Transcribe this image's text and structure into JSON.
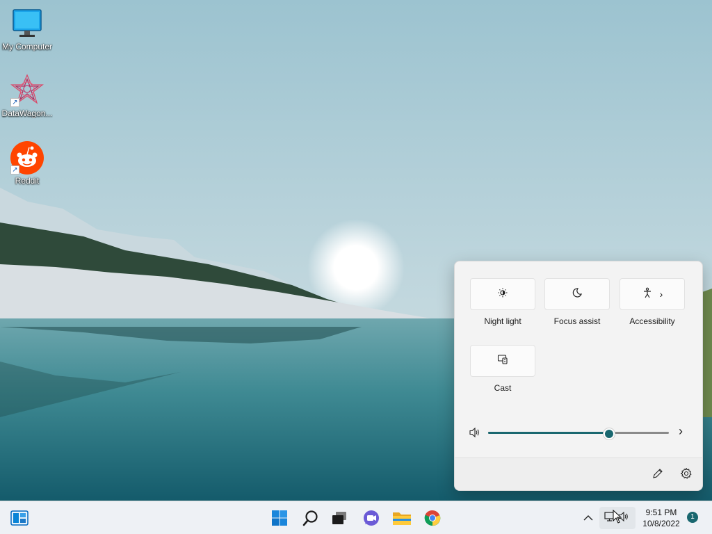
{
  "desktop": {
    "icons": [
      {
        "label": "My Computer"
      },
      {
        "label": "DataWagon..."
      },
      {
        "label": "Reddit"
      }
    ]
  },
  "quick_settings": {
    "tiles": [
      {
        "label": "Night light",
        "icon": "brightness-icon"
      },
      {
        "label": "Focus assist",
        "icon": "moon-icon"
      },
      {
        "label": "Accessibility",
        "icon": "accessibility-icon",
        "chevron": "›"
      },
      {
        "label": "Cast",
        "icon": "cast-icon"
      }
    ],
    "volume": {
      "level": 0.67,
      "icon": "speaker-icon",
      "chevron": "›"
    },
    "footer": {
      "edit_icon": "pencil-icon",
      "settings_icon": "gear-icon"
    }
  },
  "taskbar": {
    "apps": [
      "widgets-icon",
      "start-icon",
      "search-icon",
      "task-view-icon",
      "chat-icon",
      "file-explorer-icon",
      "chrome-icon"
    ],
    "tray_chevron": "^",
    "clock": {
      "time": "9:51 PM",
      "date": "10/8/2022"
    },
    "notification_count": "1"
  },
  "colors": {
    "accent": "#19676f",
    "reddit": "#ff4500"
  }
}
